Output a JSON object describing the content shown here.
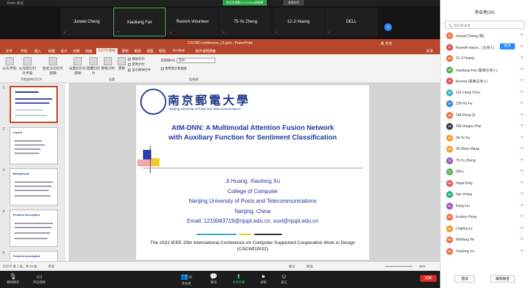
{
  "window": {
    "title": "Zoom 会议",
    "banner": "你正在观看12-Ji Huang的屏幕",
    "view_button": "查看选项"
  },
  "video_strip": {
    "tiles": [
      {
        "name": "Junwei Cheng",
        "active": false
      },
      {
        "name": "Xiaoliang Fan",
        "active": true
      },
      {
        "name": "RoomA-Volunteer",
        "active": false
      },
      {
        "name": "75-Yu Zheng",
        "active": false
      },
      {
        "name": "12-Ji Huang",
        "active": false
      },
      {
        "name": "DELL",
        "active": false
      }
    ],
    "next_icon": "chevron-right-icon"
  },
  "ppt": {
    "file_title": "CSCWD conference_12.pptx - PowerPoint",
    "user": "黄 吉浩",
    "share": "共享",
    "tabs": [
      "文件",
      "开始",
      "插入",
      "绘图",
      "设计",
      "切换",
      "动画",
      "幻灯片放映",
      "录制",
      "审阅",
      "视图",
      "帮助",
      "Acrobat",
      "操作说明搜索"
    ],
    "selected_tab": "幻灯片放映",
    "ribbon": {
      "buttons": [
        "从头开始",
        "从当前幻灯片开始",
        "自定义幻灯片放映",
        "设置幻灯片放映",
        "隐藏幻灯片",
        "排练计时",
        "录制"
      ],
      "group1": "开始放映幻灯片",
      "group2": "设置",
      "group3": "监视器",
      "checks": [
        "播放旁白",
        "使用计时",
        "显示媒体控件"
      ],
      "monitor_label": "监视器(M):",
      "monitor_value": "自动",
      "presenter_view": "使用演示者视图"
    },
    "thumbs": [
      {
        "num": "1",
        "head": ""
      },
      {
        "num": "2",
        "head": "Layout"
      },
      {
        "num": "3",
        "head": "Background"
      },
      {
        "num": "4",
        "head": "Problem Description"
      },
      {
        "num": "5",
        "head": "Problem Description"
      }
    ],
    "slide": {
      "univ_name": "南京郵電大學",
      "univ_en": "Nanjing University of Posts and Telecommunications",
      "title1": "AtM-DNN: A Multimodal Attention Fusion Network",
      "title2": "with Auxiliary Function for Sentiment Classification",
      "authors": "Ji Huang, Xiaolong Xu",
      "college": "College of Computer",
      "university": "Nanjing University of Posts and Telecommunications",
      "city": "Nanjing, China",
      "email": "Email: 1219043719@njupt.edu.cn, xuxl@njupt.edu.cn",
      "conf1": "The 2022 IEEE 25th International Conference on Computer Supported Cooperative Work in Design",
      "conf2": "(CSCWD2022)"
    },
    "status": {
      "slide_info": "幻灯片 第 1 张，共 15 张",
      "lang": "英语",
      "notes": "备注",
      "comments": "批注",
      "zoom": "85%"
    }
  },
  "toolbar": {
    "buttons": [
      "解除静音",
      "开启视频",
      "参会者",
      "聊天",
      "共享屏幕",
      "录制",
      "反应"
    ],
    "participant_count": "20",
    "end": "结束"
  },
  "panel": {
    "title": "参会者(20)",
    "search_placeholder": "查找参会者",
    "more_button": "更多",
    "people": [
      {
        "initials": "JC",
        "name": "Junwei Cheng (我)",
        "color": "#e8734a"
      },
      {
        "initials": "R",
        "name": "RoomA-Volunt... (主持人)",
        "color": "#e0565b"
      },
      {
        "initials": "1H",
        "name": "12-Ji Huang",
        "color": "#e8734a"
      },
      {
        "initials": "XF",
        "name": "Xiaoliang Fan (联席主持人)",
        "color": "#5ab25a"
      },
      {
        "initials": "R",
        "name": "RoomA (联席主持人)",
        "color": "#e0565b"
      },
      {
        "initials": "1C",
        "name": "131-Liang Chen",
        "color": "#3cb4c8"
      },
      {
        "initials": "1F",
        "name": "135-Hu Fa",
        "color": "#3c8ad8"
      },
      {
        "initials": "1Q",
        "name": "146-Peng Qi",
        "color": "#e8734a"
      },
      {
        "initials": "1Z",
        "name": "165-Xieguo Zhai",
        "color": "#3c3c3c"
      },
      {
        "initials": "2S",
        "name": "24-Ye Su",
        "color": "#f0a030"
      },
      {
        "initials": "3W",
        "name": "36-Zihan Wang",
        "color": "#f0a030"
      },
      {
        "initials": "7Z",
        "name": "75-Yu Zheng",
        "color": "#9b59b6"
      },
      {
        "initials": "D",
        "name": "DELL",
        "color": "#5ab25a"
      },
      {
        "initials": "HD",
        "name": "Haijie Ding",
        "color": "#e0565b"
      },
      {
        "initials": "HZ",
        "name": "hao zhang",
        "color": "#2aa888"
      },
      {
        "initials": "KL",
        "name": "Kang Liu",
        "color": "#9b59b6"
      },
      {
        "initials": "KP",
        "name": "Kunkun Peng",
        "color": "#e8734a"
      },
      {
        "initials": "LL",
        "name": "Lingling Lu",
        "color": "#f0a030"
      },
      {
        "initials": "WH",
        "name": "Weiliang He",
        "color": "#e8734a"
      },
      {
        "initials": "XX",
        "name": "Xiaolong Xu",
        "color": "#e8734a"
      }
    ],
    "invite": "邀请",
    "mute_all": "解除静音"
  }
}
